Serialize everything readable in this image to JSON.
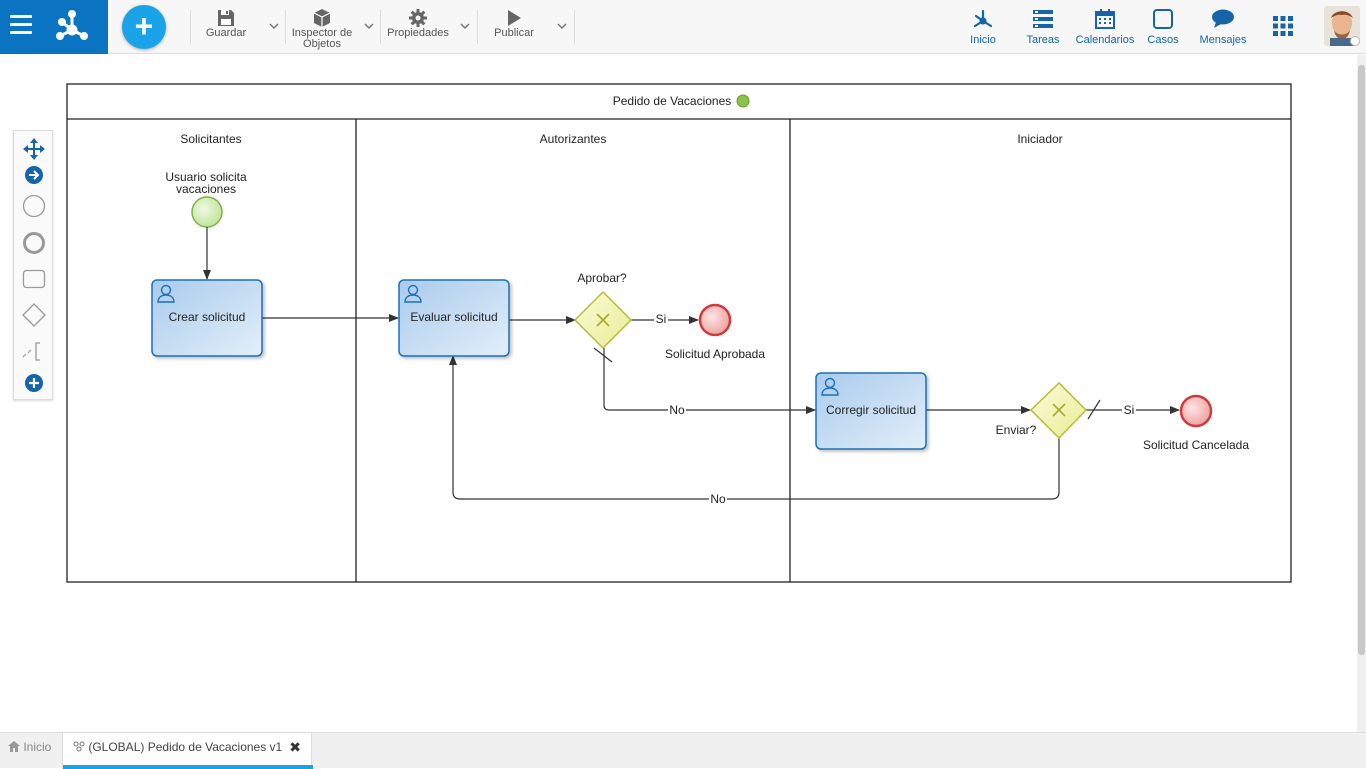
{
  "toolbar": {
    "new_label": "+",
    "save_label": "Guardar",
    "inspector_label_1": "Inspector de",
    "inspector_label_2": "Objetos",
    "properties_label": "Propiedades",
    "publish_label": "Publicar"
  },
  "nav": {
    "home": "Inicio",
    "tasks": "Tareas",
    "calendars": "Calendarios",
    "cases": "Casos",
    "messages": "Mensajes"
  },
  "diagram": {
    "pool_title": "Pedido de Vacaciones",
    "status_color": "#8bc34a",
    "lanes": [
      "Solicitantes",
      "Autorizantes",
      "Iniciador"
    ],
    "start_event_line1": "Usuario solicita",
    "start_event_line2": "vacaciones",
    "tasks": [
      "Crear solicitud",
      "Evaluar solicitud",
      "Corregir solicitud"
    ],
    "gateway_approve": "Aprobar?",
    "gateway_send": "Enviar?",
    "end_approved": "Solicitud Aprobada",
    "end_cancelled": "Solicitud Cancelada",
    "flow_yes": "Si",
    "flow_no": "No"
  },
  "tabs": {
    "home": "Inicio",
    "process": "(GLOBAL) Pedido de Vacaciones v1",
    "close": "✖"
  },
  "colors": {
    "brand": "#0a73c2",
    "accent": "#1aa3e8",
    "task_border": "#1b6fb8",
    "gateway_fill": "#f3f5b4",
    "end_fill": "#f2a0a0",
    "start_fill": "#cfeab0"
  }
}
